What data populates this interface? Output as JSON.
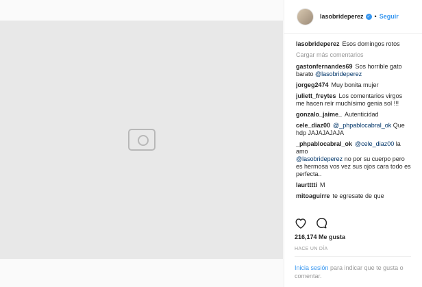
{
  "post": {
    "author": "lasobrideperez",
    "follow_label": "Seguir",
    "caption": "Esos domingos rotos",
    "load_more": "Cargar más comentarios",
    "likes": "216,174 Me gusta",
    "time": "HACE UN DÍA",
    "login_link": "Inicia sesión",
    "login_text": " para indicar que te gusta o comentar.",
    "photo_icon": "image-placeholder-icon",
    "action_icons": [
      "heart-icon",
      "comment-icon"
    ],
    "verified_icon": "verified-badge-icon"
  },
  "comments": [
    {
      "user": "gastonfernandes69",
      "text": "Sos horrible gato barato ",
      "mention": "@lasobrideperez",
      "after": ""
    },
    {
      "user": "jorgeg2474",
      "text": "Muy bonita mujer",
      "mention": "",
      "after": ""
    },
    {
      "user": "juliett_freytes",
      "text": "Los comentarios virgos me hacen reír muchísimo genia sol !!!",
      "mention": "",
      "after": ""
    },
    {
      "user": "gonzalo_jaime_",
      "text": "Autenticidad",
      "mention": "",
      "after": ""
    },
    {
      "user": "cele_diaz00",
      "text": "",
      "mention": "@_phpablocabral_ok",
      "after": " Que hdp JAJAJAJAJA"
    },
    {
      "user": "_phpablocabral_ok",
      "text": "",
      "mention": "@cele_diaz00",
      "after": " la amo"
    },
    {
      "user": "",
      "text": "",
      "mention": "@lasobrideperez",
      "after": " no por su cuerpo pero es hermosa vos vez sus ojos cara todo es perfecta.."
    },
    {
      "user": "laurtttti",
      "text": "M",
      "mention": "",
      "after": ""
    },
    {
      "user": "mitoaguirre",
      "text": "te egresate de que",
      "mention": "",
      "after": ""
    }
  ]
}
